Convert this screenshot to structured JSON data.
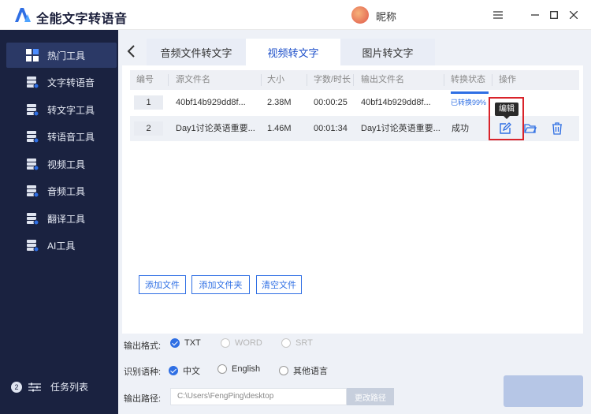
{
  "app": {
    "title": "全能文字转语音",
    "nickname": "昵称"
  },
  "sidebar": {
    "items": [
      {
        "label": "热门工具",
        "icon": "grid-icon",
        "active": true
      },
      {
        "label": "文字转语音",
        "icon": "stack-icon"
      },
      {
        "label": "转文字工具",
        "icon": "stack-icon"
      },
      {
        "label": "转语音工具",
        "icon": "stack-icon"
      },
      {
        "label": "视频工具",
        "icon": "stack-icon"
      },
      {
        "label": "音频工具",
        "icon": "stack-icon"
      },
      {
        "label": "翻译工具",
        "icon": "stack-icon"
      },
      {
        "label": "AI工具",
        "icon": "stack-icon"
      }
    ],
    "task_count": "2",
    "task_label": "任务列表"
  },
  "tabs": [
    {
      "label": "音频文件转文字",
      "active": false
    },
    {
      "label": "视频转文字",
      "active": true
    },
    {
      "label": "图片转文字",
      "active": false
    }
  ],
  "table": {
    "headers": [
      "编号",
      "源文件名",
      "大小",
      "字数/时长",
      "输出文件名",
      "转换状态",
      "操作"
    ],
    "rows": [
      {
        "num": "1",
        "source": "40bf14b929dd8f...",
        "size": "2.38M",
        "duration": "00:00:25",
        "output": "40bf14b929dd8f...",
        "status": "已转换99%",
        "progress": 0.99
      },
      {
        "num": "2",
        "source": "Day1讨论英语重要...",
        "size": "1.46M",
        "duration": "00:01:34",
        "output": "Day1讨论英语重要...",
        "status": "成功"
      }
    ]
  },
  "tooltip": "编辑",
  "buttons": {
    "add_file": "添加文件",
    "add_folder": "添加文件夹",
    "clear": "清空文件"
  },
  "output_format": {
    "label": "输出格式:",
    "options": [
      {
        "label": "TXT",
        "checked": true
      },
      {
        "label": "WORD",
        "checked": false,
        "disabled": true
      },
      {
        "label": "SRT",
        "checked": false,
        "disabled": true
      }
    ]
  },
  "language": {
    "label": "识别语种:",
    "options": [
      {
        "label": "中文",
        "checked": true
      },
      {
        "label": "English",
        "checked": false
      },
      {
        "label": "其他语言",
        "checked": false
      }
    ]
  },
  "path": {
    "label": "输出路径:",
    "value": "C:\\Users\\FengPing\\desktop",
    "change_label": "更改路径"
  },
  "colors": {
    "sidebar": "#1a2240",
    "accent": "#2f6fe4",
    "highlight": "#d9232a"
  }
}
